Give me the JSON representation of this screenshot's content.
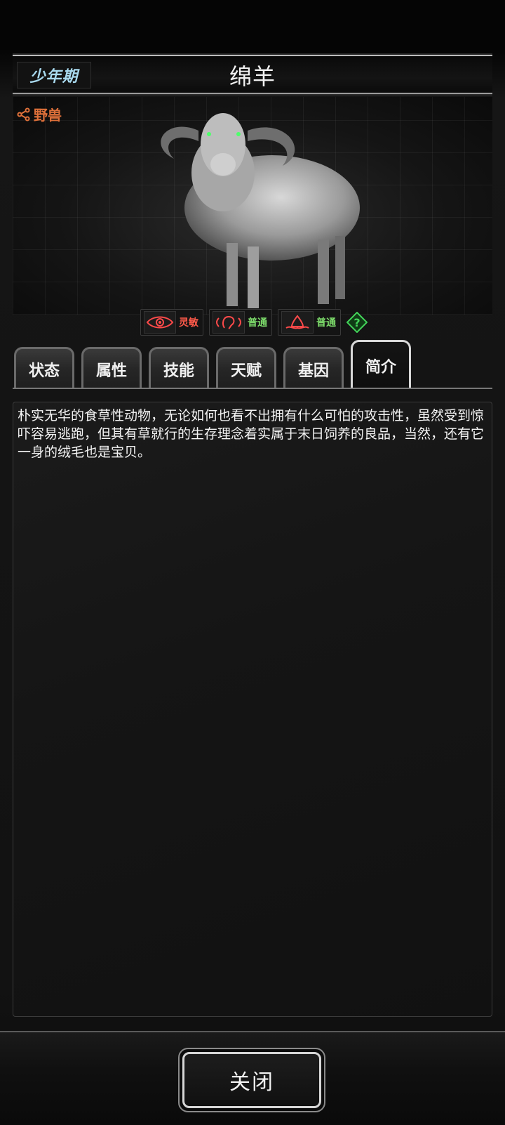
{
  "header": {
    "stage": "少年期",
    "creature_name": "绵羊"
  },
  "image_area": {
    "type_link": "野兽",
    "type_link_color": "#e0713a"
  },
  "traits": [
    {
      "icon": "eye-icon",
      "label": "灵敏",
      "color": "#ff5a4a"
    },
    {
      "icon": "ear-icon",
      "label": "普通",
      "color": "#7ddc6b"
    },
    {
      "icon": "nose-icon",
      "label": "普通",
      "color": "#7ddc6b"
    }
  ],
  "tabs": [
    {
      "label": "状态",
      "active": false
    },
    {
      "label": "属性",
      "active": false
    },
    {
      "label": "技能",
      "active": false
    },
    {
      "label": "天赋",
      "active": false
    },
    {
      "label": "基因",
      "active": false
    },
    {
      "label": "简介",
      "active": true
    }
  ],
  "description": {
    "text": "朴实无华的食草性动物，无论如何也看不出拥有什么可怕的攻击性，虽然受到惊吓容易逃跑，但其有草就行的生存理念着实属于末日饲养的良品，当然，还有它一身的绒毛也是宝贝。"
  },
  "footer": {
    "close_label": "关闭"
  }
}
